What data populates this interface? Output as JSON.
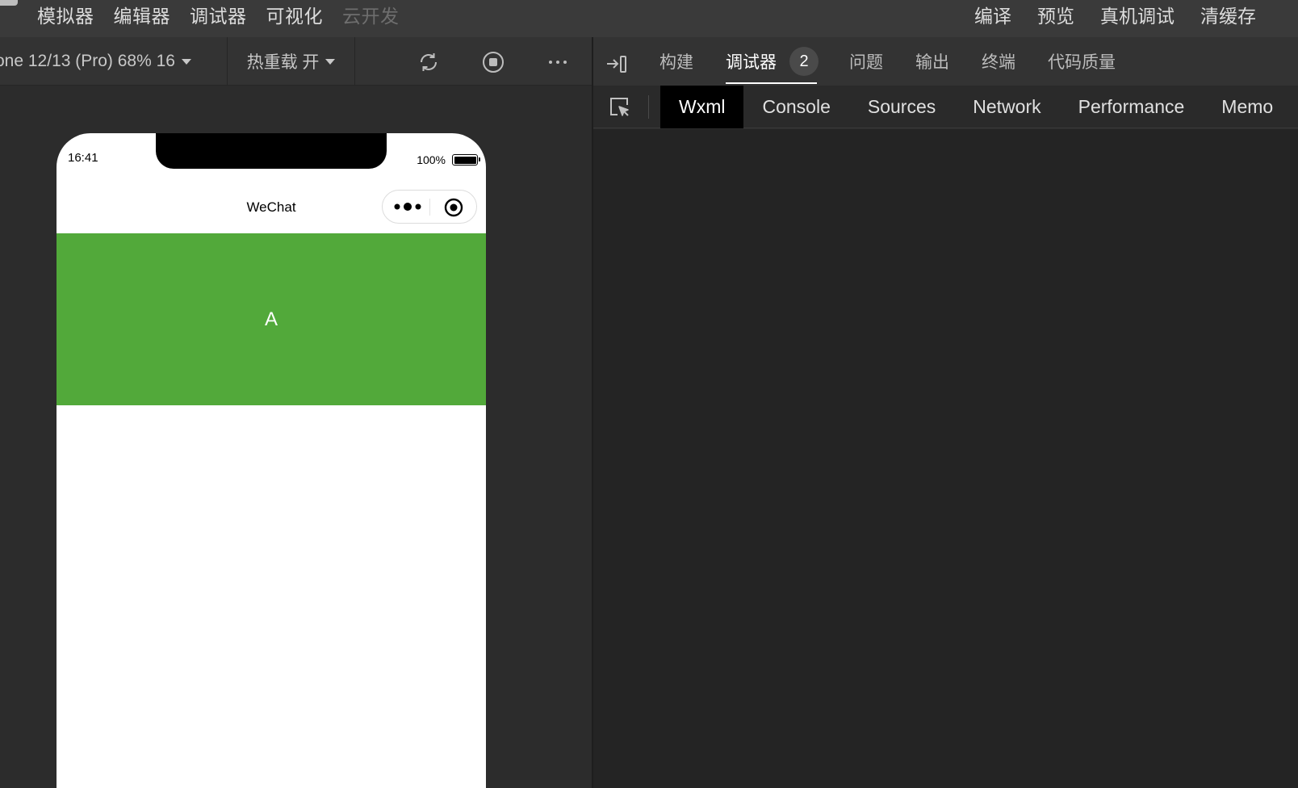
{
  "menubar": {
    "left_items": [
      "模拟器",
      "编辑器",
      "调试器",
      "可视化",
      "云开发"
    ],
    "right_items": [
      "编译",
      "预览",
      "真机调试",
      "清缓存"
    ]
  },
  "sim_toolbar": {
    "device_label": "one 12/13 (Pro) 68% 16",
    "hot_reload_label": "热重载 开",
    "icons": [
      "refresh-icon",
      "stop-icon",
      "more-icon"
    ]
  },
  "phone": {
    "status_time": "16:41",
    "battery_percent": "100%",
    "nav_title": "WeChat",
    "block_text": "A",
    "block_color": "#52a93a"
  },
  "devtools": {
    "top_tabs": [
      {
        "label": "构建",
        "active": false
      },
      {
        "label": "调试器",
        "active": true,
        "badge": "2"
      },
      {
        "label": "问题",
        "active": false
      },
      {
        "label": "输出",
        "active": false
      },
      {
        "label": "终端",
        "active": false
      },
      {
        "label": "代码质量",
        "active": false
      }
    ],
    "sub_tabs": [
      {
        "label": "Wxml",
        "active": true
      },
      {
        "label": "Console",
        "active": false
      },
      {
        "label": "Sources",
        "active": false
      },
      {
        "label": "Network",
        "active": false
      },
      {
        "label": "Performance",
        "active": false
      },
      {
        "label": "Memo",
        "active": false
      }
    ]
  }
}
